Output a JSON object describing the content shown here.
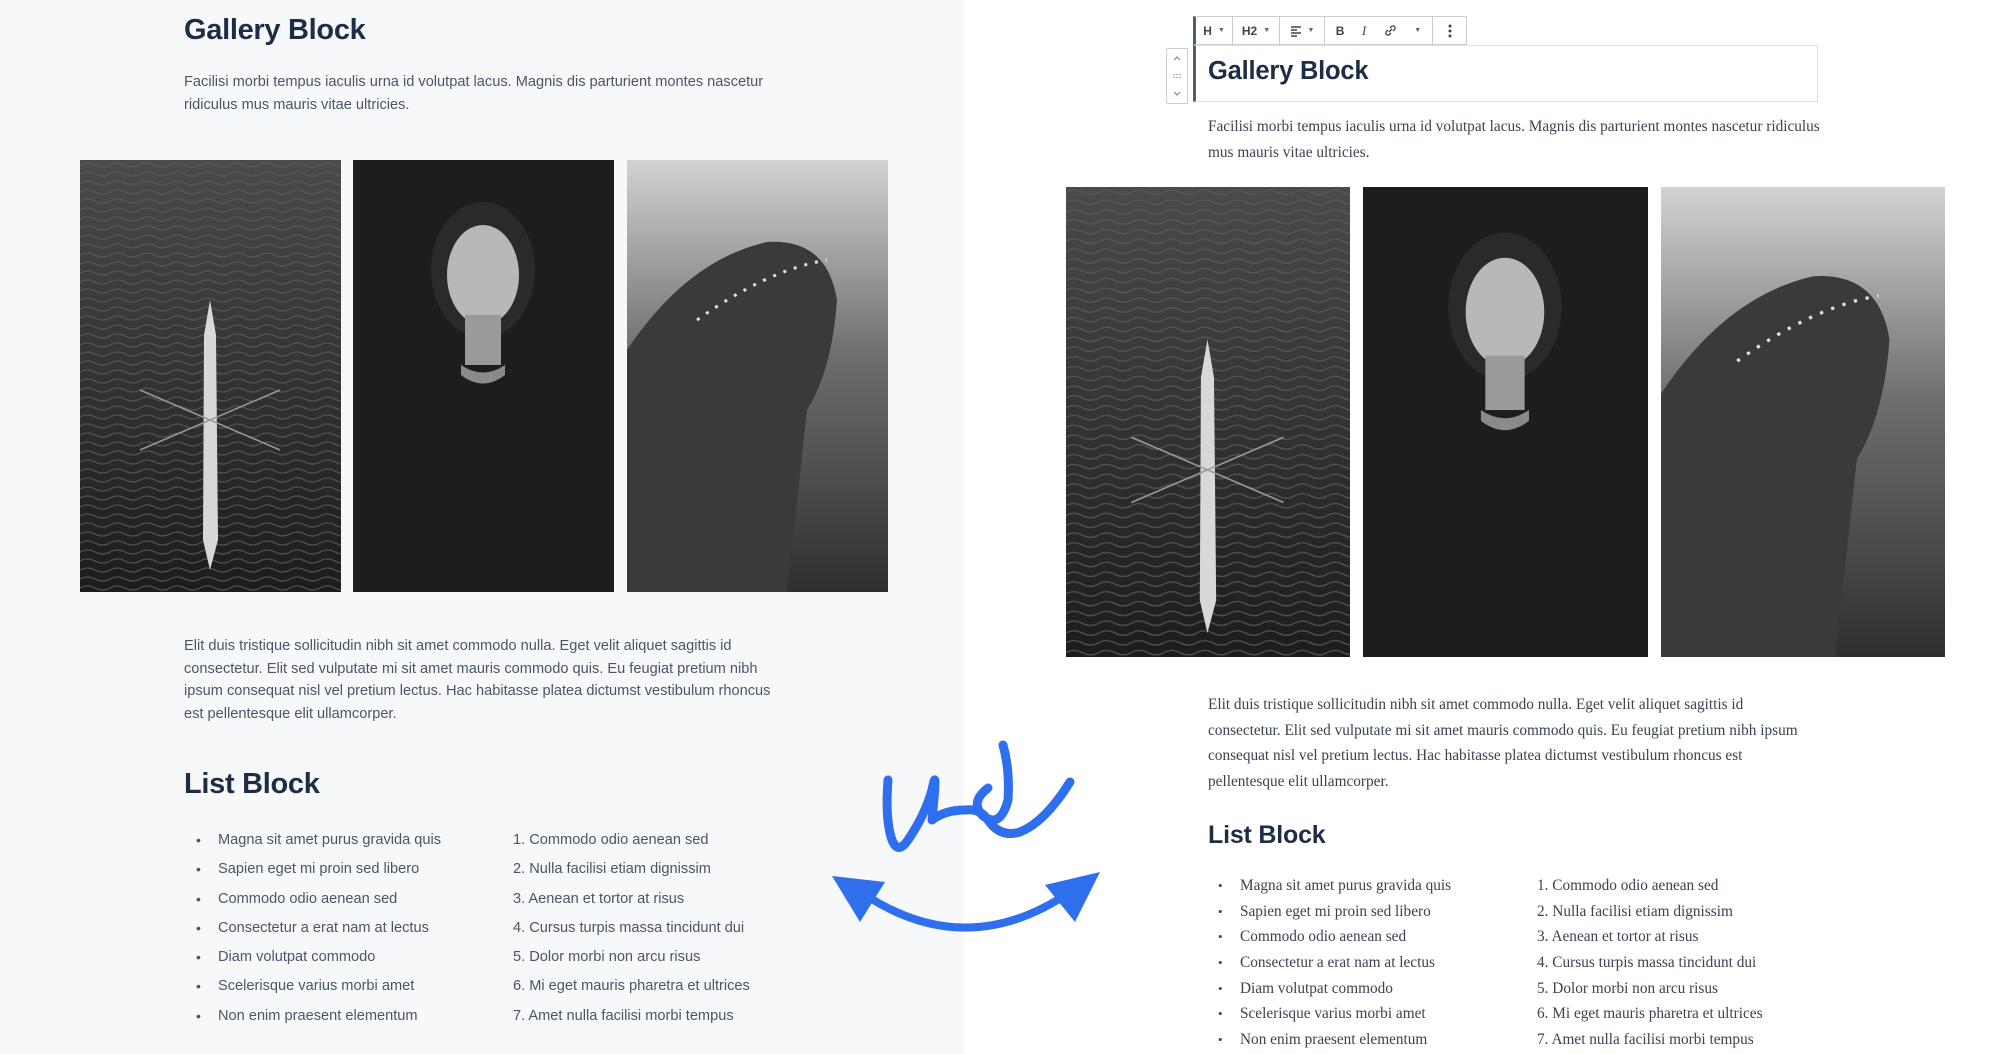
{
  "left": {
    "gallery_heading": "Gallery Block",
    "gallery_intro": "Facilisi morbi tempus iaculis urna id volutpat lacus. Magnis dis parturient montes nascetur ridiculus mus mauris vitae ultricies.",
    "images": [
      {
        "alt": "Aerial view of rowing boat on dark water"
      },
      {
        "alt": "Portrait of woman on black background"
      },
      {
        "alt": "Profile of girl with flower crown"
      }
    ],
    "body_paragraph": "Elit duis tristique sollicitudin nibh sit amet commodo nulla. Eget velit aliquet sagittis id consectetur. Elit sed vulputate mi sit amet mauris commodo quis. Eu feugiat pretium nibh ipsum consequat nisl vel pretium lectus. Hac habitasse platea dictumst vestibulum rhoncus est pellentesque elit ullamcorper.",
    "list_heading": "List Block",
    "unordered_items": [
      "Magna sit amet purus gravida quis",
      "Sapien eget mi proin sed libero",
      "Commodo odio aenean sed",
      "Consectetur a erat nam at lectus",
      "Diam volutpat commodo",
      "Scelerisque varius morbi amet",
      "Non enim praesent elementum"
    ],
    "ordered_items": [
      "1. Commodo odio aenean sed",
      "2. Nulla facilisi etiam dignissim",
      "3. Aenean et tortor at risus",
      "4. Cursus turpis massa tincidunt dui",
      "5. Dolor morbi non arcu risus",
      "6. Mi eget mauris pharetra et ultrices",
      "7. Amet nulla facilisi morbi tempus"
    ]
  },
  "right": {
    "toolbar": {
      "block_type": "H",
      "heading_level": "H2",
      "align_icon": "align-left-icon",
      "bold": "B",
      "italic": "I",
      "link_icon": "link-icon",
      "more_icon": "more-vertical-icon"
    },
    "mover": {
      "up": "chevron-up-icon",
      "drag": "drag-handle-icon",
      "down": "chevron-down-icon"
    },
    "gallery_heading": "Gallery Block",
    "gallery_intro": "Facilisi morbi tempus iaculis urna id volutpat lacus. Magnis dis parturient montes nascetur ridiculus mus mauris vitae ultricies.",
    "body_paragraph": "Elit duis tristique sollicitudin nibh sit amet commodo nulla. Eget velit aliquet sagittis id consectetur. Elit sed vulputate mi sit amet mauris commodo quis. Eu feugiat pretium nibh ipsum consequat nisl vel pretium lectus. Hac habitasse platea dictumst vestibulum rhoncus est pellentesque elit ullamcorper.",
    "list_heading": "List Block",
    "unordered_items": [
      "Magna sit amet purus gravida quis",
      "Sapien eget mi proin sed libero",
      "Commodo odio aenean sed",
      "Consectetur a erat nam at lectus",
      "Diam volutpat commodo",
      "Scelerisque varius morbi amet",
      "Non enim praesent elementum"
    ],
    "ordered_items": [
      "1. Commodo odio aenean sed",
      "2. Nulla facilisi etiam dignissim",
      "3. Aenean et tortor at risus",
      "4. Cursus turpis massa tincidunt dui",
      "5. Dolor morbi non arcu risus",
      "6. Mi eget mauris pharetra et ultrices",
      "7. Amet nulla facilisi morbi tempus"
    ]
  },
  "comparison_label": "vs",
  "colors": {
    "accent": "#2f6fed",
    "heading": "#1e2d47",
    "left_background": "#f7f8fa",
    "right_background": "#ffffff"
  }
}
